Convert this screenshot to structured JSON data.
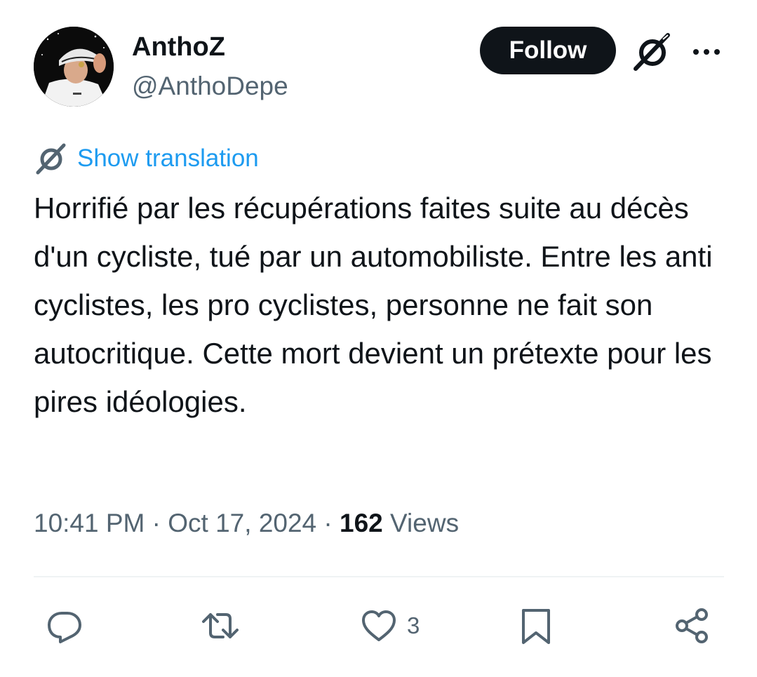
{
  "author": {
    "display_name": "AnthoZ",
    "handle": "@AnthoDepe"
  },
  "header": {
    "follow_label": "Follow"
  },
  "translate": {
    "label": "Show translation"
  },
  "tweet": {
    "text": "Horrifié par les récupérations faites suite au décès d'un cycliste, tué par un automobiliste. Entre les anti cyclistes, les pro cyclistes, personne ne fait son autocritique. Cette mort devient un prétexte pour les pires idéologies."
  },
  "meta": {
    "time": "10:41 PM",
    "separator": "·",
    "date": "Oct 17, 2024",
    "views_count": "162",
    "views_label": "Views"
  },
  "actions": {
    "like_count": "3"
  },
  "icons": {
    "avatar": "avatar-photo",
    "grok": "grok-icon",
    "more": "more-icon",
    "translate": "grok-icon",
    "reply": "reply-icon",
    "retweet": "retweet-icon",
    "like": "heart-icon",
    "bookmark": "bookmark-icon",
    "share": "share-icon"
  },
  "colors": {
    "text_primary": "#0f1419",
    "text_secondary": "#536471",
    "link": "#1d9bf0",
    "follow_bg": "#0f1419",
    "divider": "#eff3f4"
  }
}
